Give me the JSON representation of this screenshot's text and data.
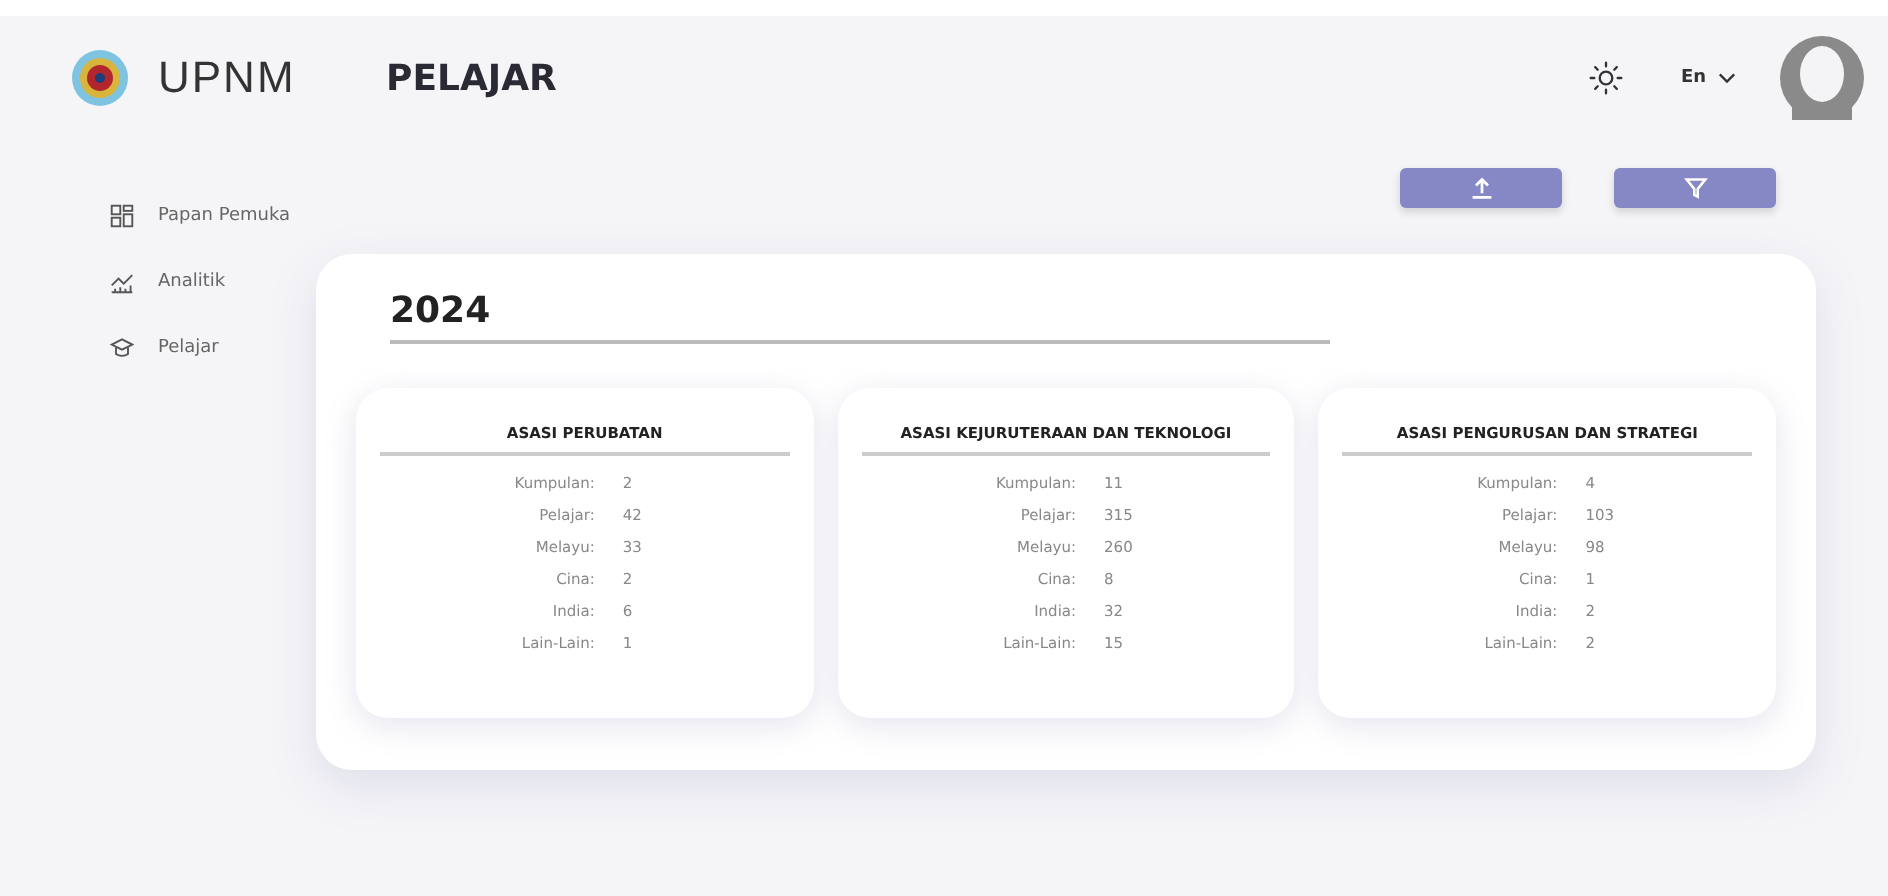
{
  "brand": "UPNM",
  "page_title": "PELAJAR",
  "language": "En",
  "sidebar": {
    "items": [
      {
        "label": "Papan Pemuka"
      },
      {
        "label": "Analitik"
      },
      {
        "label": "Pelajar"
      }
    ]
  },
  "year": "2024",
  "faculties": [
    {
      "title": "ASASI PERUBATAN",
      "rows": [
        {
          "label": "Kumpulan:",
          "value": "2"
        },
        {
          "label": "Pelajar:",
          "value": "42"
        },
        {
          "label": "Melayu:",
          "value": "33"
        },
        {
          "label": "Cina:",
          "value": "2"
        },
        {
          "label": "India:",
          "value": "6"
        },
        {
          "label": "Lain-Lain:",
          "value": "1"
        }
      ]
    },
    {
      "title": "ASASI KEJURUTERAAN DAN TEKNOLOGI",
      "rows": [
        {
          "label": "Kumpulan:",
          "value": "11"
        },
        {
          "label": "Pelajar:",
          "value": "315"
        },
        {
          "label": "Melayu:",
          "value": "260"
        },
        {
          "label": "Cina:",
          "value": "8"
        },
        {
          "label": "India:",
          "value": "32"
        },
        {
          "label": "Lain-Lain:",
          "value": "15"
        }
      ]
    },
    {
      "title": "ASASI PENGURUSAN DAN STRATEGI",
      "rows": [
        {
          "label": "Kumpulan:",
          "value": "4"
        },
        {
          "label": "Pelajar:",
          "value": "103"
        },
        {
          "label": "Melayu:",
          "value": "98"
        },
        {
          "label": "Cina:",
          "value": "1"
        },
        {
          "label": "India:",
          "value": "2"
        },
        {
          "label": "Lain-Lain:",
          "value": "2"
        }
      ]
    }
  ]
}
